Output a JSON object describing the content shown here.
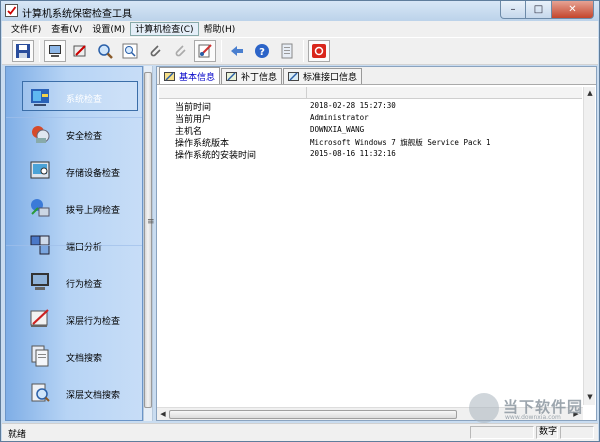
{
  "window": {
    "title": "计算机系统保密检查工具",
    "controls": {
      "minimize": "–",
      "maximize": "□",
      "close": "✕"
    }
  },
  "menu": [
    {
      "label": "文件(F)"
    },
    {
      "label": "查看(V)"
    },
    {
      "label": "设置(M)"
    },
    {
      "label": "计算机检查(C)",
      "active": true
    },
    {
      "label": "帮助(H)"
    }
  ],
  "toolbar": {
    "buttons": [
      "save-icon",
      "computer-icon",
      "pen-icon",
      "magnifier-icon",
      "zoom-window-icon",
      "paperclip-icon",
      "paperclip-gray-icon",
      "tools-icon",
      "arrow-icon",
      "help-icon",
      "document-icon",
      "stop-icon"
    ]
  },
  "nav": [
    {
      "label": "系统检查",
      "icon": "system-check-icon",
      "selected": true
    },
    {
      "label": "安全检查",
      "icon": "security-check-icon"
    },
    {
      "label": "存储设备检查",
      "icon": "storage-check-icon"
    },
    {
      "label": "拨号上网检查",
      "icon": "dialup-check-icon"
    },
    {
      "label": "端口分析",
      "icon": "port-analysis-icon"
    },
    {
      "label": "行为检查",
      "icon": "behavior-check-icon"
    },
    {
      "label": "深层行为检查",
      "icon": "deep-behavior-check-icon"
    },
    {
      "label": "文档搜索",
      "icon": "document-search-icon"
    },
    {
      "label": "深层文档搜索",
      "icon": "deep-document-search-icon"
    }
  ],
  "tabs": [
    {
      "label": "基本信息",
      "active": true
    },
    {
      "label": "补丁信息"
    },
    {
      "label": "标准接口信息"
    }
  ],
  "info_rows": [
    {
      "key": "当前时间",
      "value": "2018-02-28 15:27:30"
    },
    {
      "key": "当前用户",
      "value": "Administrator"
    },
    {
      "key": "主机名",
      "value": "DOWNXIA_WANG"
    },
    {
      "key": "操作系统版本",
      "value": "Microsoft Windows 7 旗舰版  Service Pack 1"
    },
    {
      "key": "操作系统的安装时间",
      "value": "2015-08-16 11:32:16"
    }
  ],
  "statusbar": {
    "text": "就绪",
    "num_indicator": "数字"
  },
  "watermark": {
    "text": "当下软件园",
    "url": "www.downxia.com"
  }
}
